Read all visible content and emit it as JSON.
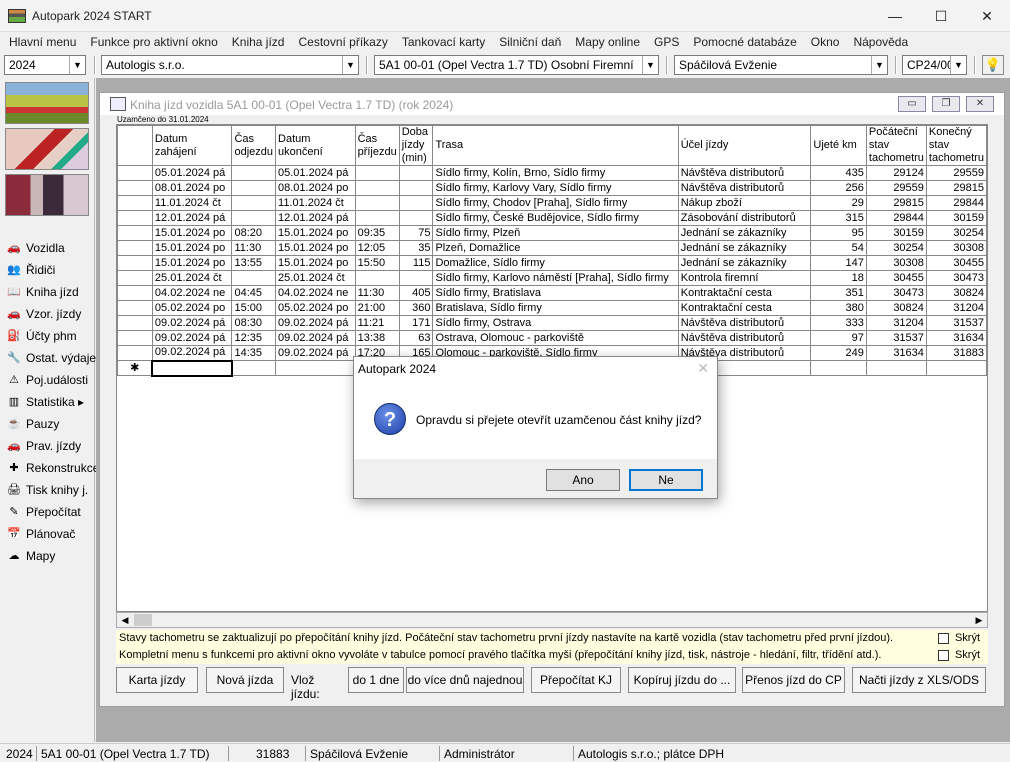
{
  "app": {
    "title": "Autopark 2024 START"
  },
  "window_controls": {
    "minimize": "—",
    "maximize": "☐",
    "close": "✕"
  },
  "menu": [
    "Hlavní menu",
    "Funkce pro aktivní okno",
    "Kniha jízd",
    "Cestovní příkazy",
    "Tankovací karty",
    "Silniční daň",
    "Mapy online",
    "GPS",
    "Pomocné databáze",
    "Okno",
    "Nápověda"
  ],
  "toolbar": {
    "year": "2024",
    "company": "Autologis s.r.o.",
    "vehicle": "5A1 00-01 (Opel Vectra 1.7 TD) Osobní Firemní",
    "driver": "Spáčilová Evženie",
    "trip_id": "CP24/00"
  },
  "sidebar": [
    {
      "icon": "car-icon",
      "glyph": "🚗",
      "label": "Vozidla"
    },
    {
      "icon": "drivers-icon",
      "glyph": "👥",
      "label": "Řidiči"
    },
    {
      "icon": "book-icon",
      "glyph": "📖",
      "label": "Kniha jízd"
    },
    {
      "icon": "template-trips-icon",
      "glyph": "🚗",
      "label": "Vzor. jízdy"
    },
    {
      "icon": "fuel-accounts-icon",
      "glyph": "⛽",
      "label": "Účty phm"
    },
    {
      "icon": "expenses-icon",
      "glyph": "🔧",
      "label": "Ostat. výdaje"
    },
    {
      "icon": "warning-icon",
      "glyph": "⚠",
      "label": "Poj.události"
    },
    {
      "icon": "statistics-icon",
      "glyph": "▥",
      "label": "Statistika ▸"
    },
    {
      "icon": "breaks-icon",
      "glyph": "☕",
      "label": "Pauzy"
    },
    {
      "icon": "private-trips-icon",
      "glyph": "🚗",
      "label": "Prav. jízdy"
    },
    {
      "icon": "reconstruction-icon",
      "glyph": "✚",
      "label": "Rekonstrukce"
    },
    {
      "icon": "print-icon",
      "glyph": "🖨",
      "label": "Tisk knihy j."
    },
    {
      "icon": "recalculate-icon",
      "glyph": "✎",
      "label": "Přepočítat"
    },
    {
      "icon": "planner-icon",
      "glyph": "📅",
      "label": "Plánovač"
    },
    {
      "icon": "map-icon",
      "glyph": "☁",
      "label": "Mapy"
    }
  ],
  "child_window": {
    "title": "Kniha jízd vozidla  5A1 00-01 (Opel Vectra 1.7 TD) (rok 2024)",
    "locked_note": "Uzamčeno do 31.01.2024"
  },
  "table": {
    "headers": [
      "Datum zahájení",
      "Čas odjezdu",
      "Datum ukončení",
      "Čas příjezdu",
      "Doba jízdy (min)",
      "Trasa",
      "Účel jízdy",
      "Ujeté km",
      "Počáteční stav tachometru",
      "Konečný stav tachometru"
    ],
    "rows": [
      [
        "05.01.2024 pá",
        "",
        "05.01.2024 pá",
        "",
        "",
        "Sídlo firmy, Kolín, Brno, Sídlo firmy",
        "Návštěva distributorů",
        "435",
        "29124",
        "29559"
      ],
      [
        "08.01.2024 po",
        "",
        "08.01.2024 po",
        "",
        "",
        "Sídlo firmy, Karlovy Vary, Sídlo firmy",
        "Návštěva distributorů",
        "256",
        "29559",
        "29815"
      ],
      [
        "11.01.2024 čt",
        "",
        "11.01.2024 čt",
        "",
        "",
        "Sídlo firmy, Chodov [Praha], Sídlo firmy",
        "Nákup zboží",
        "29",
        "29815",
        "29844"
      ],
      [
        "12.01.2024 pá",
        "",
        "12.01.2024 pá",
        "",
        "",
        "Sídlo firmy, České Budějovice, Sídlo firmy",
        "Zásobování distributorů",
        "315",
        "29844",
        "30159"
      ],
      [
        "15.01.2024 po",
        "08:20",
        "15.01.2024 po",
        "09:35",
        "75",
        "Sídlo firmy, Plzeň",
        "Jednání se zákazníky",
        "95",
        "30159",
        "30254"
      ],
      [
        "15.01.2024 po",
        "11:30",
        "15.01.2024 po",
        "12:05",
        "35",
        "Plzeň, Domažlice",
        "Jednání se zákazníky",
        "54",
        "30254",
        "30308"
      ],
      [
        "15.01.2024 po",
        "13:55",
        "15.01.2024 po",
        "15:50",
        "115",
        "Domažlice, Sídlo firmy",
        "Jednání se zákazníky",
        "147",
        "30308",
        "30455"
      ],
      [
        "25.01.2024 čt",
        "",
        "25.01.2024 čt",
        "",
        "",
        "Sídlo firmy, Karlovo náměstí [Praha], Sídlo firmy",
        "Kontrola firemní",
        "18",
        "30455",
        "30473"
      ],
      [
        "04.02.2024 ne",
        "04:45",
        "04.02.2024 ne",
        "11:30",
        "405",
        "Sídlo firmy, Bratislava",
        "Kontraktační cesta",
        "351",
        "30473",
        "30824"
      ],
      [
        "05.02.2024 po",
        "15:00",
        "05.02.2024 po",
        "21:00",
        "360",
        "Bratislava, Sídlo firmy",
        "Kontraktační cesta",
        "380",
        "30824",
        "31204"
      ],
      [
        "09.02.2024 pá",
        "08:30",
        "09.02.2024 pá",
        "11:21",
        "171",
        "Sídlo firmy, Ostrava",
        "Návštěva distributorů",
        "333",
        "31204",
        "31537"
      ],
      [
        "09.02.2024 pá",
        "12:35",
        "09.02.2024 pá",
        "13:38",
        "63",
        "Ostrava, Olomouc - parkoviště",
        "Návštěva distributorů",
        "97",
        "31537",
        "31634"
      ],
      [
        "09.02.2024 pá",
        "14:35",
        "09.02.2024 pá",
        "17:20",
        "165",
        "Olomouc - parkoviště, Sídlo firmy",
        "Návštěva distributorů",
        "249",
        "31634",
        "31883"
      ]
    ],
    "new_row_marker": "✱"
  },
  "notes": [
    {
      "text": "Stavy tachometru se zaktualizují po přepočítání knihy jízd. Počáteční stav tachometru první jízdy nastavíte na kartě vozidla (stav tachometru před první jízdou).",
      "hide_label": "Skrýt"
    },
    {
      "text": "Kompletní menu s funkcemi pro aktivní okno vyvoláte v tabulce pomocí pravého tlačítka myši (přepočítání knihy jízd, tisk, nástroje - hledání, filtr, třídění atd.).",
      "hide_label": "Skrýt"
    }
  ],
  "buttons": {
    "vehicle_card": "Karta jízdy",
    "new_trip": "Nová jízda",
    "insert_label": "Vlož jízdu:",
    "one_day": "do 1 dne",
    "multi_day": "do více dnů najednou",
    "recalculate": "Přepočítat KJ",
    "copy_trip": "Kopíruj jízdu do ...",
    "transfer": "Přenos jízd do CP",
    "load_xls": "Načti jízdy z XLS/ODS"
  },
  "statusbar": {
    "year": "2024",
    "vehicle": "5A1 00-01 (Opel Vectra 1.7 TD)",
    "odometer": "31883",
    "driver": "Spáčilová Evženie",
    "user": "Administrátor",
    "company": "Autologis s.r.o.;  plátce DPH"
  },
  "dialog": {
    "title": "Autopark 2024",
    "message": "Opravdu si přejete otevřít uzamčenou část knihy jízd?",
    "yes": "Ano",
    "no": "Ne",
    "close": "✕"
  }
}
